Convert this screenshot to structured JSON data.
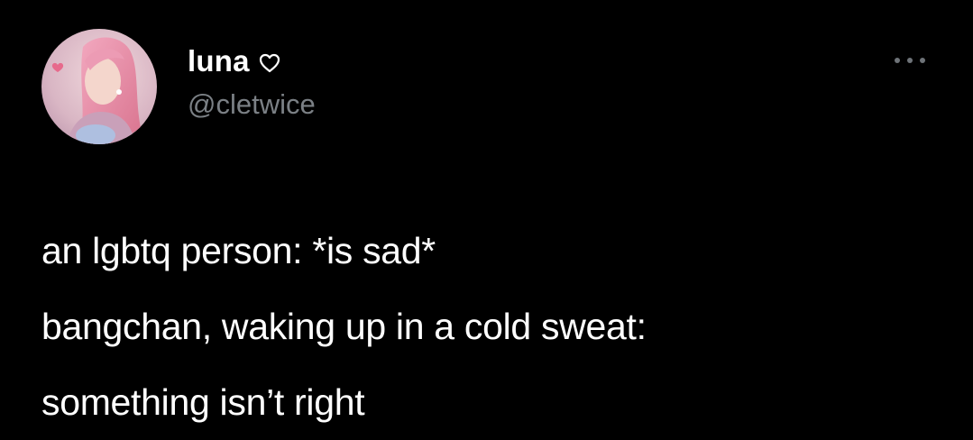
{
  "user": {
    "display_name": "luna",
    "handle": "@cletwice"
  },
  "icons": {
    "verified_style": "heart-outline-icon",
    "more": "more-horizontal-icon"
  },
  "tweet": {
    "lines": [
      "an lgbtq person: *is sad*",
      "bangchan, waking up in a cold sweat:",
      "something isn’t right"
    ]
  },
  "colors": {
    "background": "#000000",
    "text": "#ffffff",
    "handle": "#7b8085"
  }
}
